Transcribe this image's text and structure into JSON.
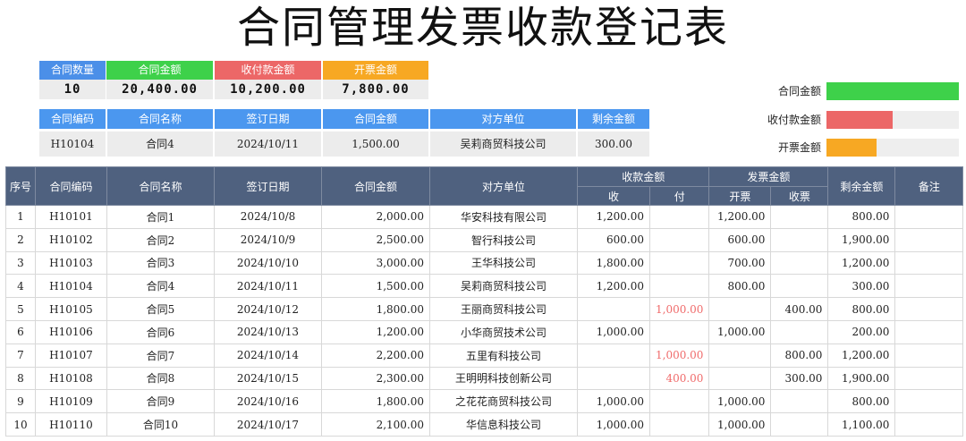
{
  "title": "合同管理发票收款登记表",
  "summary": {
    "items": [
      {
        "label": "合同数量",
        "value": "10",
        "color": "#4b8fe8"
      },
      {
        "label": "合同金额",
        "value": "20,400.00",
        "color": "#3ed14a"
      },
      {
        "label": "收付款金额",
        "value": "10,200.00",
        "color": "#ec6767"
      },
      {
        "label": "开票金额",
        "value": "7,800.00",
        "color": "#f7a823"
      }
    ]
  },
  "lookup": {
    "headers": [
      "合同编码",
      "合同名称",
      "签订日期",
      "合同金额",
      "对方单位",
      "剩余金额"
    ],
    "values": [
      "H10104",
      "合同4",
      "2024/10/11",
      "1,500.00",
      "吴莉商贸科技公司",
      "300.00"
    ]
  },
  "bars": [
    {
      "label": "合同金额",
      "fraction": 1.0,
      "color": "#3ed14a"
    },
    {
      "label": "收付款金额",
      "fraction": 0.5,
      "color": "#ec6767"
    },
    {
      "label": "开票金额",
      "fraction": 0.38,
      "color": "#f7a823"
    }
  ],
  "table": {
    "headers": {
      "seq": "序号",
      "code": "合同编码",
      "name": "合同名称",
      "date": "签订日期",
      "amount": "合同金额",
      "party": "对方单位",
      "payment": "收款金额",
      "recv": "收",
      "pay": "付",
      "invoice": "发票金额",
      "issue": "开票",
      "receive": "收票",
      "remaining": "剩余金额",
      "note": "备注"
    },
    "rows": [
      {
        "seq": "1",
        "code": "H10101",
        "name": "合同1",
        "date": "2024/10/8",
        "amount": "2,000.00",
        "party": "华安科技有限公司",
        "recv": "1,200.00",
        "pay": "",
        "issue": "1,200.00",
        "receive": "",
        "remaining": "800.00",
        "note": ""
      },
      {
        "seq": "2",
        "code": "H10102",
        "name": "合同2",
        "date": "2024/10/9",
        "amount": "2,500.00",
        "party": "智行科技公司",
        "recv": "600.00",
        "pay": "",
        "issue": "600.00",
        "receive": "",
        "remaining": "1,900.00",
        "note": ""
      },
      {
        "seq": "3",
        "code": "H10103",
        "name": "合同3",
        "date": "2024/10/10",
        "amount": "3,000.00",
        "party": "王华科技公司",
        "recv": "1,800.00",
        "pay": "",
        "issue": "700.00",
        "receive": "",
        "remaining": "1,200.00",
        "note": ""
      },
      {
        "seq": "4",
        "code": "H10104",
        "name": "合同4",
        "date": "2024/10/11",
        "amount": "1,500.00",
        "party": "吴莉商贸科技公司",
        "recv": "1,200.00",
        "pay": "",
        "issue": "800.00",
        "receive": "",
        "remaining": "300.00",
        "note": ""
      },
      {
        "seq": "5",
        "code": "H10105",
        "name": "合同5",
        "date": "2024/10/12",
        "amount": "1,800.00",
        "party": "王丽商贸科技公司",
        "recv": "",
        "pay": "1,000.00",
        "issue": "",
        "receive": "400.00",
        "remaining": "800.00",
        "note": ""
      },
      {
        "seq": "6",
        "code": "H10106",
        "name": "合同6",
        "date": "2024/10/13",
        "amount": "1,200.00",
        "party": "小华商贸技术公司",
        "recv": "1,000.00",
        "pay": "",
        "issue": "1,000.00",
        "receive": "",
        "remaining": "200.00",
        "note": ""
      },
      {
        "seq": "7",
        "code": "H10107",
        "name": "合同7",
        "date": "2024/10/14",
        "amount": "2,200.00",
        "party": "五里有科技公司",
        "recv": "",
        "pay": "1,000.00",
        "issue": "",
        "receive": "800.00",
        "remaining": "1,200.00",
        "note": ""
      },
      {
        "seq": "8",
        "code": "H10108",
        "name": "合同8",
        "date": "2024/10/15",
        "amount": "2,300.00",
        "party": "王明明科技创新公司",
        "recv": "",
        "pay": "400.00",
        "issue": "",
        "receive": "300.00",
        "remaining": "1,900.00",
        "note": ""
      },
      {
        "seq": "9",
        "code": "H10109",
        "name": "合同9",
        "date": "2024/10/16",
        "amount": "1,800.00",
        "party": "之花花商贸科技公司",
        "recv": "1,000.00",
        "pay": "",
        "issue": "1,000.00",
        "receive": "",
        "remaining": "800.00",
        "note": ""
      },
      {
        "seq": "10",
        "code": "H10110",
        "name": "合同10",
        "date": "2024/10/17",
        "amount": "2,100.00",
        "party": "华信息科技公司",
        "recv": "1,000.00",
        "pay": "",
        "issue": "1,000.00",
        "receive": "",
        "remaining": "1,100.00",
        "note": ""
      }
    ]
  }
}
